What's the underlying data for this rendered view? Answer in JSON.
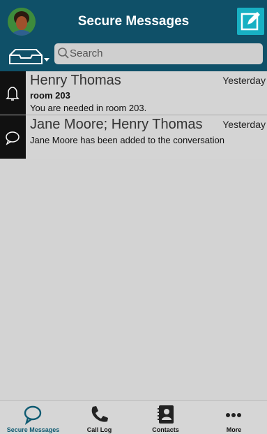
{
  "header": {
    "title": "Secure Messages",
    "avatar_icon": "user-photo",
    "compose_icon": "compose-icon"
  },
  "search": {
    "placeholder": "Search",
    "inbox_icon": "inbox-tray-icon"
  },
  "conversations": [
    {
      "name": "Henry Thomas",
      "time": "Yesterday",
      "subject": "room 203",
      "preview": "You are needed in room 203.",
      "type_icon": "bell-icon"
    },
    {
      "name": "Jane Moore; Henry Thomas",
      "time": "Yesterday",
      "subject": "",
      "preview": "Jane Moore has been added to the conversation",
      "type_icon": "chat-bubble-icon"
    }
  ],
  "tabs": [
    {
      "label": "Secure Messages",
      "icon": "chat-bubble-icon",
      "active": true
    },
    {
      "label": "Call Log",
      "icon": "phone-icon",
      "active": false
    },
    {
      "label": "Contacts",
      "icon": "contacts-book-icon",
      "active": false
    },
    {
      "label": "More",
      "icon": "more-dots-icon",
      "active": false
    }
  ],
  "colors": {
    "header": "#0f5068",
    "accent": "#18b0c3",
    "active_tab": "#0f5b72"
  }
}
